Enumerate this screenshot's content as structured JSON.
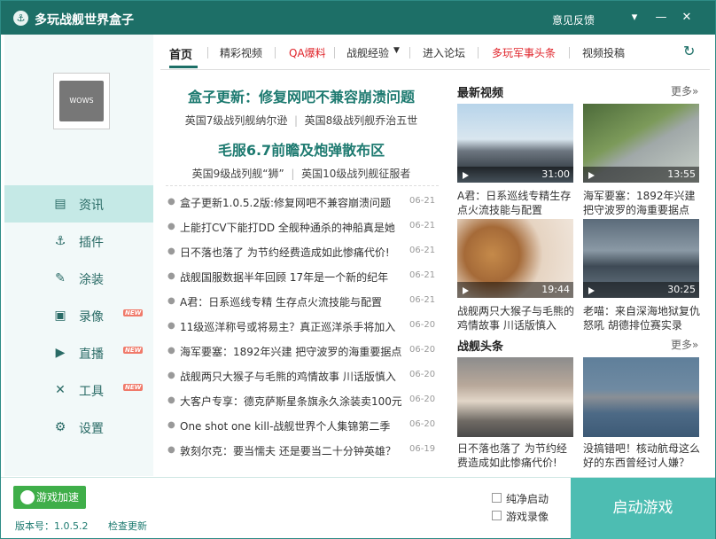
{
  "app": {
    "title": "多玩战舰世界盒子",
    "feedback": "意见反馈"
  },
  "sidebar": {
    "avatar_text": "WOWS",
    "items": [
      {
        "label": "资讯",
        "icon": "news-icon",
        "active": true,
        "new": false
      },
      {
        "label": "插件",
        "icon": "anchor-icon",
        "active": false,
        "new": false
      },
      {
        "label": "涂装",
        "icon": "paint-icon",
        "active": false,
        "new": false
      },
      {
        "label": "录像",
        "icon": "video-record-icon",
        "active": false,
        "new": true
      },
      {
        "label": "直播",
        "icon": "live-play-icon",
        "active": false,
        "new": true
      },
      {
        "label": "工具",
        "icon": "tools-icon",
        "active": false,
        "new": true
      },
      {
        "label": "设置",
        "icon": "gear-icon",
        "active": false,
        "new": false
      }
    ],
    "new_badge": "NEW"
  },
  "tabs": [
    "首页",
    "精彩视频",
    "QA爆料",
    "战舰经验",
    "进入论坛",
    "多玩军事头条",
    "视频投稿"
  ],
  "headlines": [
    {
      "title": "盒子更新：修复网吧不兼容崩溃问题",
      "subs": [
        "英国7级战列舰纳尔逊",
        "英国8级战列舰乔治五世"
      ]
    },
    {
      "title": "毛服6.7前瞻及炮弹散布区",
      "subs": [
        "英国9级战列舰“狮”",
        "英国10级战列舰征服者"
      ]
    }
  ],
  "news": [
    {
      "title": "盒子更新1.0.5.2版:修复网吧不兼容崩溃问题",
      "date": "06-21"
    },
    {
      "title": "上能打CV下能打DD 全舰种通杀的神船真是她",
      "date": "06-21"
    },
    {
      "title": "日不落也落了 为节约经费造成如此惨痛代价!",
      "date": "06-21"
    },
    {
      "title": "战舰国服数据半年回顾 17年是一个新的纪年",
      "date": "06-21"
    },
    {
      "title": "A君：日系巡线专精 生存点火流技能与配置",
      "date": "06-21"
    },
    {
      "title": "11级巡洋称号或将易主？真正巡洋杀手将加入",
      "date": "06-20"
    },
    {
      "title": "海军要塞：1892年兴建 把守波罗的海重要据点",
      "date": "06-20"
    },
    {
      "title": "战舰两只大猴子与毛熊的鸡情故事 川话版慎入",
      "date": "06-20"
    },
    {
      "title": "大客户专享：德克萨斯星条旗永久涂装卖100元",
      "date": "06-20"
    },
    {
      "title": "One shot one kill-战舰世界个人集锦第二季",
      "date": "06-20"
    },
    {
      "title": "敦刻尔克：要当懦夫 还是要当二十分钟英雄？",
      "date": "06-19"
    }
  ],
  "videos": {
    "title": "最新视频",
    "more": "更多»",
    "items": [
      {
        "title": "A君：日系巡线专精生存点火流技能与配置",
        "duration": "31:00"
      },
      {
        "title": "海军要塞：1892年兴建 把守波罗的海重要据点",
        "duration": "13:55"
      },
      {
        "title": "战舰两只大猴子与毛熊的鸡情故事 川话版慎入",
        "duration": "19:44"
      },
      {
        "title": "老喵：来自深海地狱复仇怒吼 胡德排位赛实录",
        "duration": "30:25"
      }
    ]
  },
  "warnews": {
    "title": "战舰头条",
    "more": "更多»",
    "items": [
      {
        "title": "日不落也落了 为节约经费造成如此惨痛代价!"
      },
      {
        "title": "没搞错吧！核动航母这么好的东西曾经讨人嫌？"
      }
    ]
  },
  "bottom": {
    "accelerate": "游戏加速",
    "version": "版本号：1.0.5.2",
    "check_update": "检查更新",
    "pure_start": "纯净启动",
    "game_record": "游戏录像",
    "start_game": "启动游戏"
  },
  "colors": {
    "primary": "#1d6f67",
    "accent": "#4dbdb2",
    "highlight": "#e0262c",
    "green": "#3fae49"
  }
}
